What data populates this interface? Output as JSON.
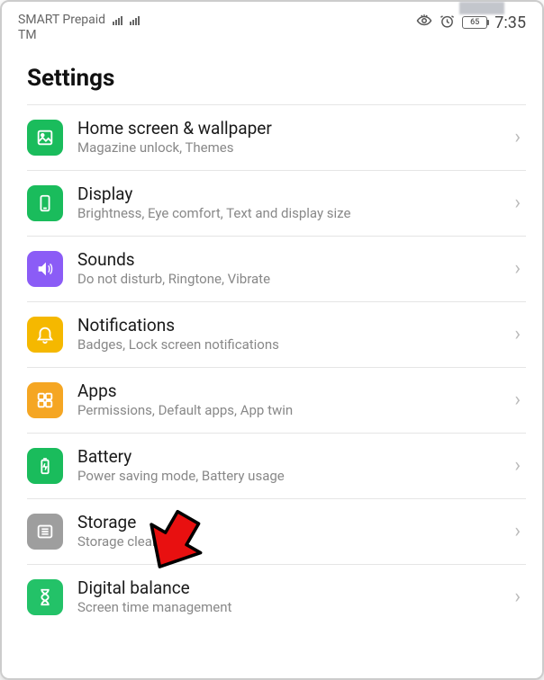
{
  "status": {
    "carrier1": "SMART Prepaid",
    "carrier2": "TM",
    "battery": "65",
    "time": "7:35"
  },
  "page": {
    "title": "Settings"
  },
  "items": [
    {
      "icon": "wallpaper-icon",
      "iconClass": "icon-green",
      "title": "Home screen & wallpaper",
      "subtitle": "Magazine unlock, Themes"
    },
    {
      "icon": "display-icon",
      "iconClass": "icon-green",
      "title": "Display",
      "subtitle": "Brightness, Eye comfort, Text and display size"
    },
    {
      "icon": "sounds-icon",
      "iconClass": "icon-purple",
      "title": "Sounds",
      "subtitle": "Do not disturb, Ringtone, Vibrate"
    },
    {
      "icon": "notifications-icon",
      "iconClass": "icon-yellow",
      "title": "Notifications",
      "subtitle": "Badges, Lock screen notifications"
    },
    {
      "icon": "apps-icon",
      "iconClass": "icon-orange",
      "title": "Apps",
      "subtitle": "Permissions, Default apps, App twin"
    },
    {
      "icon": "battery-icon",
      "iconClass": "icon-green",
      "title": "Battery",
      "subtitle": "Power saving mode, Battery usage"
    },
    {
      "icon": "storage-icon",
      "iconClass": "icon-grey",
      "title": "Storage",
      "subtitle": "Storage cleaner"
    },
    {
      "icon": "digital-balance-icon",
      "iconClass": "icon-green2",
      "title": "Digital balance",
      "subtitle": "Screen time management"
    }
  ],
  "highlight": {
    "targetIndex": 6
  }
}
